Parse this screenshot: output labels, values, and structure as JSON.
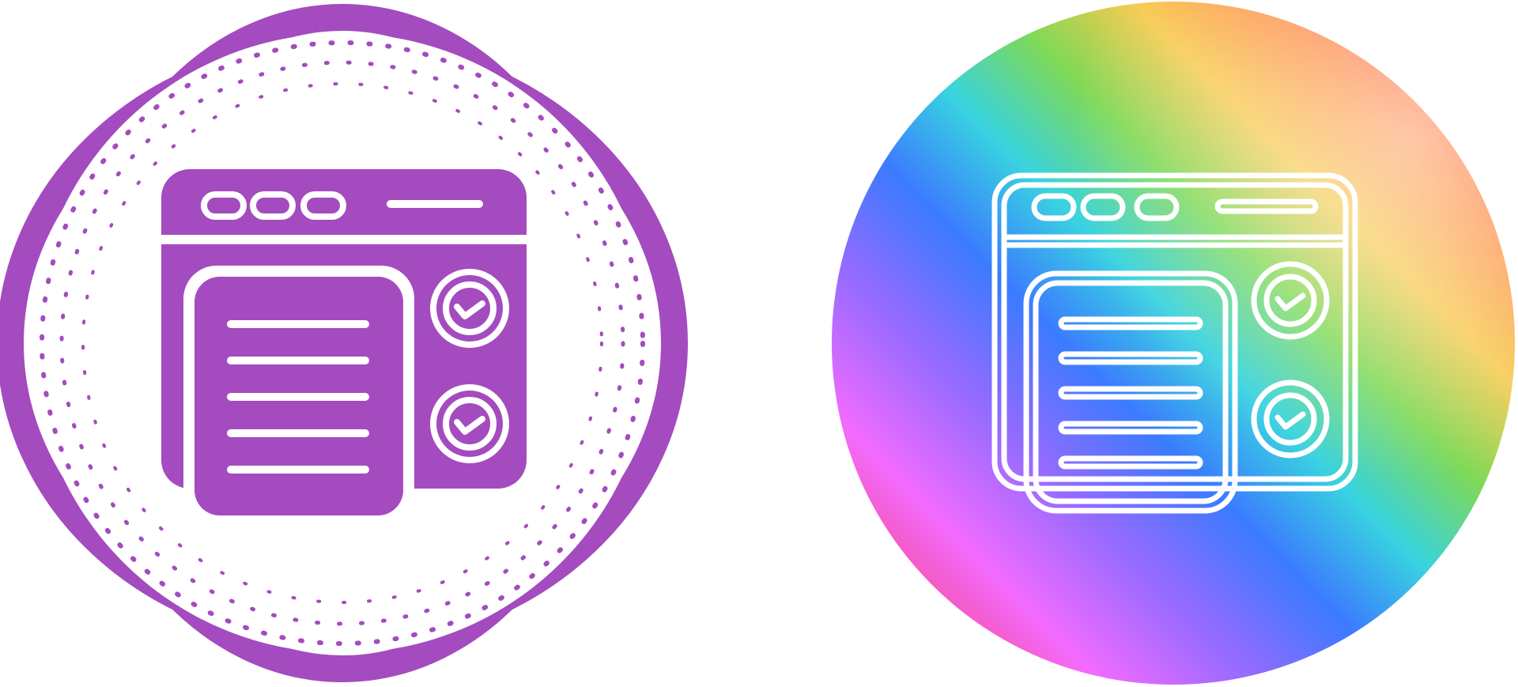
{
  "icon": {
    "name": "web-page-checklist-icon",
    "variants": [
      {
        "id": "glyph",
        "style": "solid-fill",
        "primary_color": "#a44bbf",
        "background_color": "#ffffff",
        "decoration": "four-lobed-ring-with-dotted-circles"
      },
      {
        "id": "line",
        "style": "outline",
        "stroke_color": "#ffffff",
        "background": "rainbow-gradient-circle",
        "gradient_colors": [
          "#ff3b3b",
          "#f26bff",
          "#a46bff",
          "#3b7bff",
          "#39d3e0",
          "#7ed957",
          "#f7c94b",
          "#ff7b3b",
          "#ff2d2d"
        ]
      }
    ],
    "document_lines": 5,
    "check_circles": 2,
    "window_dots": 3
  }
}
